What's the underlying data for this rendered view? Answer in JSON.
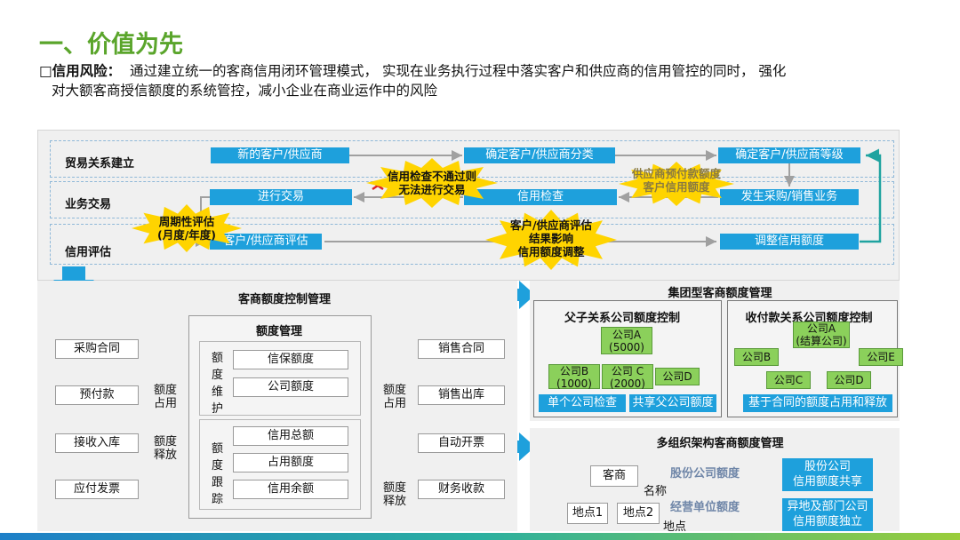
{
  "title": "一、价值为先",
  "intro": {
    "key": "信用风险：",
    "line1": "通过建立统一的客商信用闭环管理模式， 实现在业务执行过程中落实客户和供应商的信用管控的同时， 强化",
    "line2": "对大额客商授信额度的系统管控，减小企业在商业运作中的风险"
  },
  "flow": {
    "rows": {
      "r1": "贸易关系建立",
      "r2": "业务交易",
      "r3": "信用评估"
    },
    "boxes": {
      "b1": "新的客户/供应商",
      "b2": "确定客户/供应商分类",
      "b3": "确定客户/供应商等级",
      "b4": "进行交易",
      "b5": "信用检查",
      "b6": "发生采购/销售业务",
      "b7": "客户/供应商评估",
      "b8": "调整信用额度"
    },
    "stars": {
      "s1": [
        "信用检查不通过则",
        "无法进行交易"
      ],
      "s2": [
        "供应商预付款额度",
        "客户信用额度"
      ],
      "s3": [
        "周期性评估",
        "(月度/年度)"
      ],
      "s4": [
        "客户/供应商评估",
        "结果影响",
        "信用额度调整"
      ]
    }
  },
  "left": {
    "title": "客商额度控制管理",
    "purchase": [
      "采购合同",
      "预付款",
      "接收入库",
      "应付发票"
    ],
    "sales": [
      "销售合同",
      "销售出库",
      "自动开票",
      "财务收款"
    ],
    "p_occupy": "额度\n占用",
    "p_release": "额度\n释放",
    "s_occupy": "额度\n占用",
    "s_release": "额度\n释放",
    "mgmt_title": "额度管理",
    "maint_label": "额度维护",
    "maint_items": [
      "信保额度",
      "公司额度"
    ],
    "track_label": "额度跟踪",
    "track_items": [
      "信用总额",
      "占用额度",
      "信用余额"
    ]
  },
  "group": {
    "title": "集团型客商额度管理",
    "pc_title": "父子关系公司额度控制",
    "companyA": "公司A",
    "companyA_val": "(5000)",
    "companyB": "公司B",
    "companyB_val": "(1000)",
    "companyC": "公司 C",
    "companyC_val": "(2000)",
    "companyD": "公司D",
    "btn1": "单个公司检查",
    "btn2": "共享父公司额度",
    "rp_title": "收付款关系公司额度控制",
    "rpA": "公司A",
    "rpA_sub": "(结算公司)",
    "rpB": "公司B",
    "rpE": "公司E",
    "rpC": "公司C",
    "rpD": "公司D",
    "rp_btn": "基于合同的额度占用和释放"
  },
  "multi": {
    "title": "多组织架构客商额度管理",
    "merchant": "客商",
    "name_label": "名称",
    "site1": "地点1",
    "site2": "地点2",
    "site_label": "地点",
    "share_label": "股份公司额度",
    "unit_label": "经营单位额度",
    "box1": "股份公司\n信用额度共享",
    "box2": "异地及部门公司\n信用额度独立"
  }
}
